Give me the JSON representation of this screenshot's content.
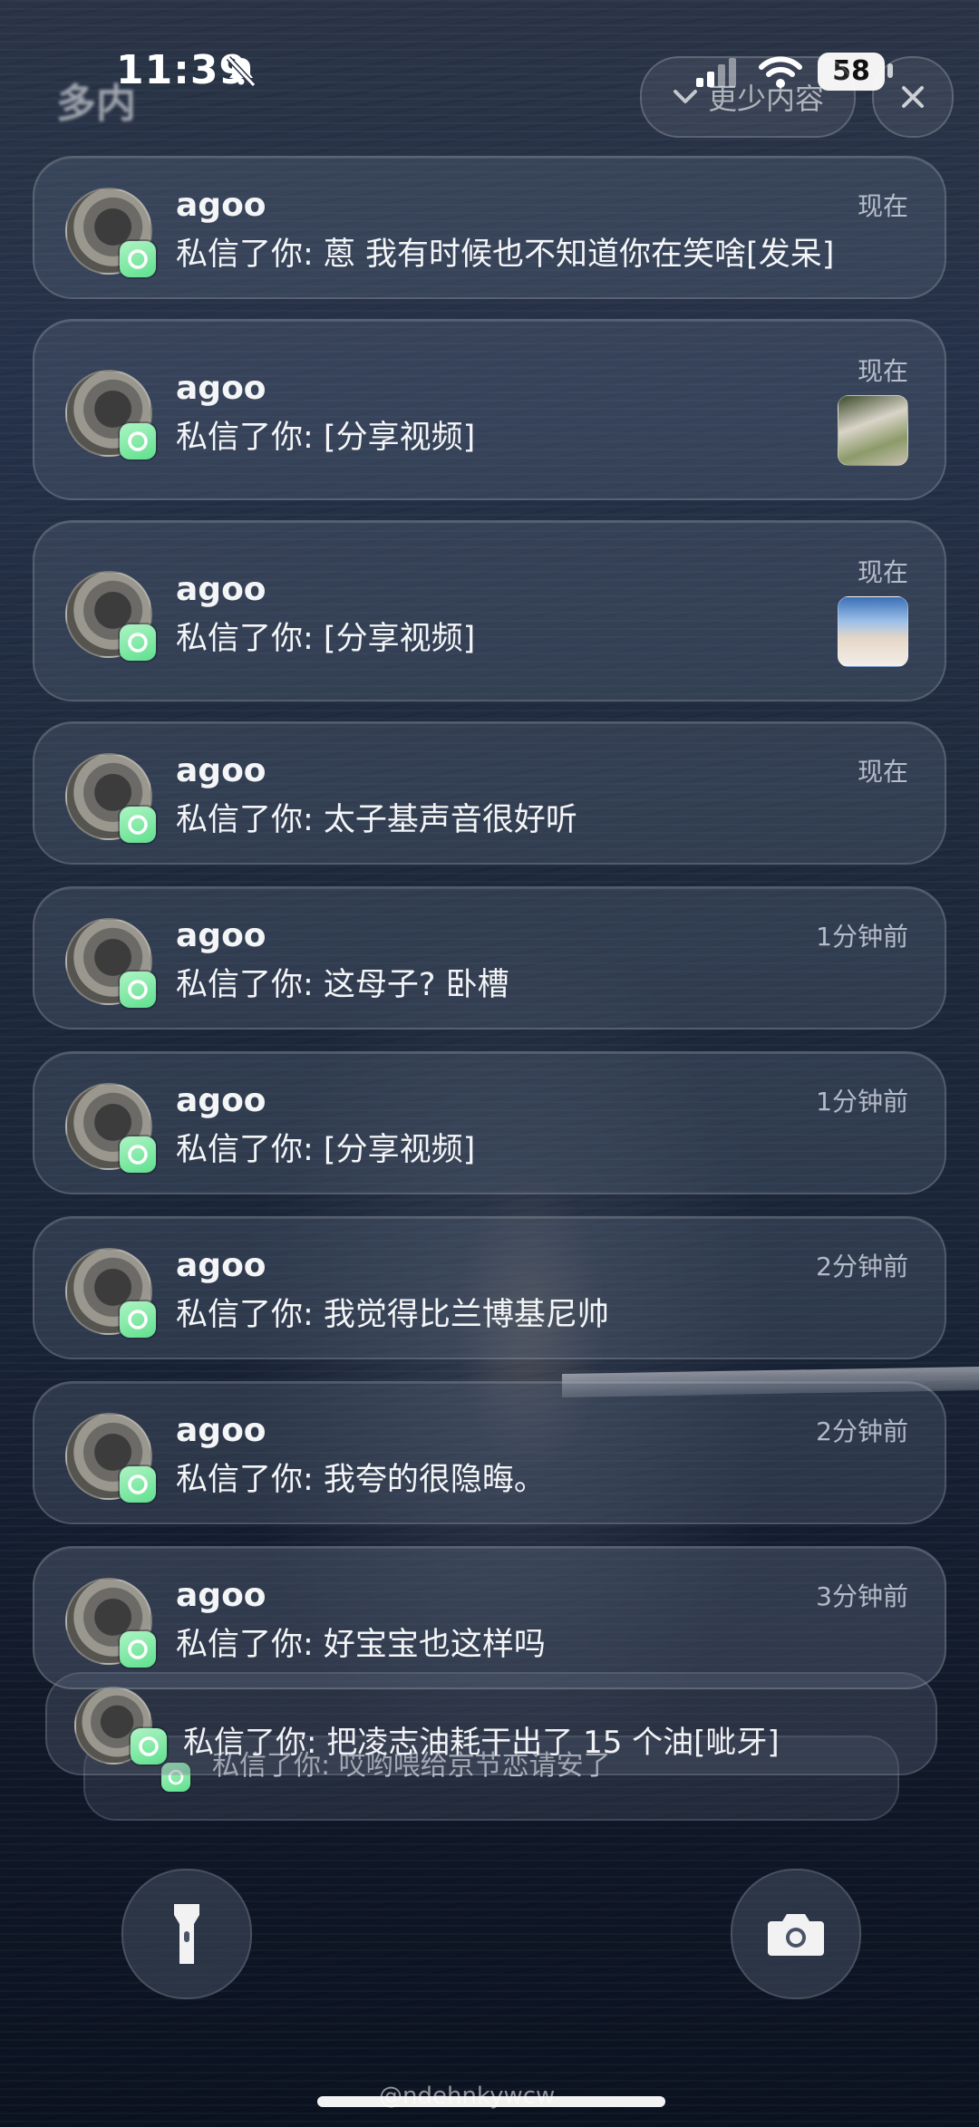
{
  "status_bar": {
    "time": "11:39",
    "battery": "58",
    "icons": [
      "bell-slash-icon",
      "signal-icon",
      "wifi-icon",
      "battery-icon"
    ]
  },
  "header": {
    "title": "多内",
    "show_less_label": "更少内容",
    "close_icon": "close-icon"
  },
  "notifications": [
    {
      "sender": "agoo",
      "message": "私信了你: 蒽 我有时候也不知道你在笑啥[发呆]",
      "time": "现在",
      "thumbnail": false
    },
    {
      "sender": "agoo",
      "message": "私信了你: [分享视频]",
      "time": "现在",
      "thumbnail": true
    },
    {
      "sender": "agoo",
      "message": "私信了你: [分享视频]",
      "time": "现在",
      "thumbnail": true
    },
    {
      "sender": "agoo",
      "message": "私信了你: 太子基声音很好听",
      "time": "现在",
      "thumbnail": false
    },
    {
      "sender": "agoo",
      "message": "私信了你: 这母子? 卧槽",
      "time": "1分钟前",
      "thumbnail": false
    },
    {
      "sender": "agoo",
      "message": "私信了你: [分享视频]",
      "time": "1分钟前",
      "thumbnail": false
    },
    {
      "sender": "agoo",
      "message": "私信了你: 我觉得比兰博基尼帅",
      "time": "2分钟前",
      "thumbnail": false
    },
    {
      "sender": "agoo",
      "message": "私信了你: 我夸的很隐晦。",
      "time": "2分钟前",
      "thumbnail": false
    },
    {
      "sender": "agoo",
      "message": "私信了你: 好宝宝也这样吗",
      "time": "3分钟前",
      "thumbnail": false
    }
  ],
  "stacked": [
    {
      "message": "私信了你: 把凌志油耗干出了 15 个油[呲牙]"
    },
    {
      "message": "私信了你: 哎哟喂给京节恋请安了"
    }
  ],
  "bottom": {
    "flashlight_icon": "flashlight-icon",
    "camera_icon": "camera-icon",
    "watermark": "@ndehnkywcw"
  },
  "colors": {
    "app_badge": "#6fe597",
    "background": "#1f2a3d"
  }
}
